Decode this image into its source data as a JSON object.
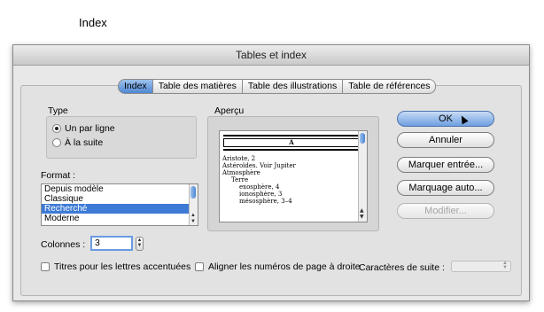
{
  "caption": "Index",
  "dialog": {
    "title": "Tables et index",
    "tabs": [
      {
        "label": "Index",
        "active": true
      },
      {
        "label": "Table des matières",
        "active": false
      },
      {
        "label": "Table des illustrations",
        "active": false
      },
      {
        "label": "Table de références",
        "active": false
      }
    ],
    "type": {
      "label": "Type",
      "options": [
        {
          "label": "Un par ligne",
          "selected": true
        },
        {
          "label": "À la suite",
          "selected": false
        }
      ]
    },
    "format": {
      "label": "Format :",
      "items": [
        "Depuis modèle",
        "Classique",
        "Recherché",
        "Moderne"
      ],
      "selected": "Recherché"
    },
    "preview": {
      "label": "Aperçu",
      "header_letter": "A",
      "lines": [
        "Aristote, 2",
        "Astéroïdes. Voir Jupiter",
        "Atmosphère",
        "Terre",
        "exosphère, 4",
        "ionosphère, 3",
        "mésosphère, 3–4"
      ]
    },
    "buttons": {
      "ok": "OK",
      "cancel": "Annuler",
      "mark_entry": "Marquer entrée...",
      "auto_mark": "Marquage auto...",
      "modify": "Modifier..."
    },
    "columns": {
      "label": "Colonnes :",
      "value": "3"
    },
    "headings_checkbox": {
      "label": "Titres pour les lettres accentuées",
      "checked": false
    },
    "align_checkbox": {
      "label": "Aligner les numéros de page à droite",
      "checked": false
    },
    "tab_leader": {
      "label": "Caractères de suite :",
      "value": "",
      "enabled": false
    }
  },
  "colors": {
    "accent": "#3d7ad6",
    "default_button": "#6e9fe0"
  }
}
